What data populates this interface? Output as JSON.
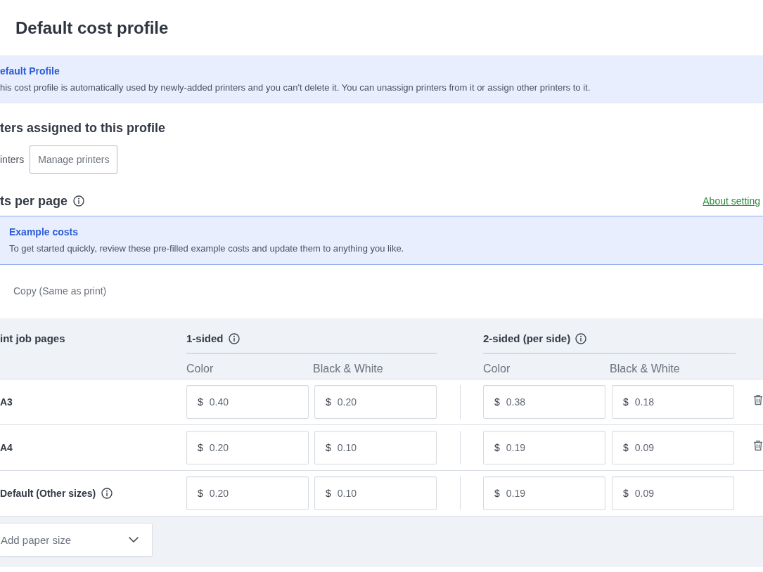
{
  "page_title": "Default cost profile",
  "profile_notice": {
    "title": "efault Profile",
    "text": "his cost profile is automatically used by newly-added printers and you can't delete it. You can unassign printers from it or assign other printers to it."
  },
  "printers_section": {
    "heading": "ters assigned to this profile",
    "label": "inters",
    "button": "Manage printers"
  },
  "costs_section": {
    "heading": "ts per page",
    "link": "About setting",
    "notice": {
      "title": "Example costs",
      "text": "To get started quickly, review these pre-filled example costs and update them to anything you like."
    }
  },
  "tabs": [
    {
      "label": "Copy (Same as print)",
      "selected": false
    }
  ],
  "cost_table": {
    "first_column": "int job pages",
    "groups": [
      {
        "label": "1-sided",
        "columns": [
          "Color",
          "Black & White"
        ]
      },
      {
        "label": "2-sided (per side)",
        "columns": [
          "Color",
          "Black & White"
        ]
      }
    ],
    "rows": [
      {
        "label": "A3",
        "info": false,
        "deletable": true,
        "values": [
          [
            {
              "currency": "$",
              "value": "0.40"
            },
            {
              "currency": "$",
              "value": "0.20"
            }
          ],
          [
            {
              "currency": "$",
              "value": "0.38"
            },
            {
              "currency": "$",
              "value": "0.18"
            }
          ]
        ]
      },
      {
        "label": "A4",
        "info": false,
        "deletable": true,
        "values": [
          [
            {
              "currency": "$",
              "value": "0.20"
            },
            {
              "currency": "$",
              "value": "0.10"
            }
          ],
          [
            {
              "currency": "$",
              "value": "0.19"
            },
            {
              "currency": "$",
              "value": "0.09"
            }
          ]
        ]
      },
      {
        "label": "Default (Other sizes)",
        "info": true,
        "deletable": false,
        "values": [
          [
            {
              "currency": "$",
              "value": "0.20"
            },
            {
              "currency": "$",
              "value": "0.10"
            }
          ],
          [
            {
              "currency": "$",
              "value": "0.19"
            },
            {
              "currency": "$",
              "value": "0.09"
            }
          ]
        ]
      }
    ],
    "add_size_dropdown": {
      "placeholder": "Add paper size"
    }
  }
}
